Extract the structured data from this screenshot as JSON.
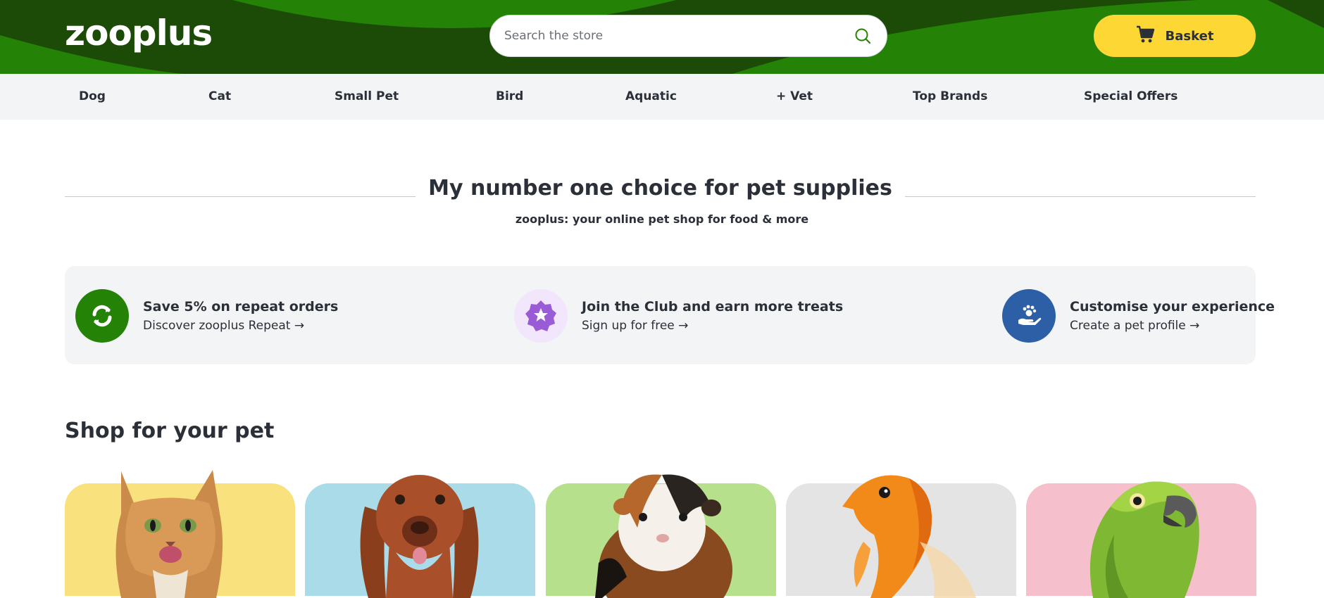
{
  "header": {
    "logo": "zooplus",
    "search": {
      "placeholder": "Search the store",
      "icon": "search-icon"
    },
    "basket": {
      "label": "Basket",
      "icon": "cart-icon"
    },
    "colors": {
      "dark_green": "#1b4b06",
      "green": "#248207",
      "yellow": "#fdd835"
    }
  },
  "nav": {
    "items": [
      "Dog",
      "Cat",
      "Small Pet",
      "Bird",
      "Aquatic",
      "+ Vet",
      "Top Brands",
      "Special Offers"
    ]
  },
  "hero": {
    "title": "My number one choice for pet supplies",
    "subtitle": "zooplus: your online pet shop for food & more"
  },
  "features": [
    {
      "title": "Save 5% on repeat orders",
      "link": "Discover zooplus Repeat →",
      "icon": "repeat-icon",
      "color": "#248207"
    },
    {
      "title": "Join the Club and earn more treats",
      "link": "Sign up for free →",
      "icon": "star-badge-icon",
      "color": "#9a5bd6"
    },
    {
      "title": "Customise your experience",
      "link": "Create a pet profile →",
      "icon": "paw-hand-icon",
      "color": "#2d5fa6"
    }
  ],
  "shop": {
    "title": "Shop for your pet",
    "cards": [
      {
        "pet": "cat",
        "color": "#f9e27d"
      },
      {
        "pet": "dog",
        "color": "#a9dbe8"
      },
      {
        "pet": "guinea-pig",
        "color": "#b6e08c"
      },
      {
        "pet": "fish",
        "color": "#e4e4e4"
      },
      {
        "pet": "parrot",
        "color": "#f5c0cb"
      }
    ]
  }
}
